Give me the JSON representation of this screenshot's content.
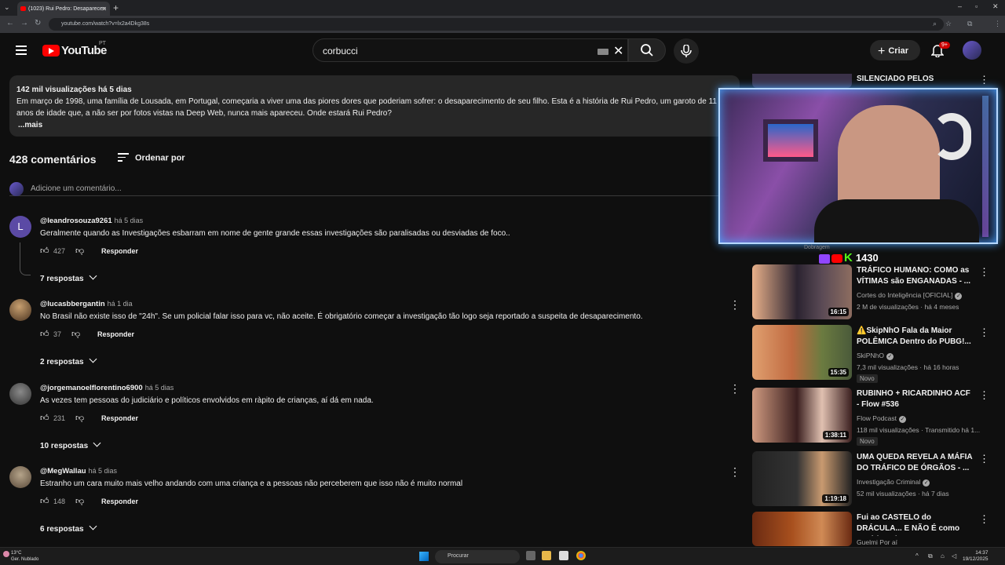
{
  "browser": {
    "tab_title": "(1023) Rui Pedro: Desaparecen",
    "url": "youtube.com/watch?v=lx2a4Dkg38s"
  },
  "header": {
    "logo_text": "YouTube",
    "region": "PT",
    "search_value": "corbucci",
    "create_label": "Criar",
    "notif_badge": "9+"
  },
  "description": {
    "meta": "142 mil visualizações  há 5 dias",
    "text": "Em março de 1998, uma família de Lousada, em Portugal, começaria a viver uma das piores dores que poderiam sofrer: o desaparecimento de seu filho. Esta é a história de Rui Pedro, um garoto de 11 anos de idade que, a não ser por fotos vistas na Deep Web, nunca mais apareceu. Onde estará Rui Pedro?",
    "more": "...mais"
  },
  "comments_header": {
    "count": "428 comentários",
    "sort_label": "Ordenar por",
    "add_placeholder": "Adicione um comentário..."
  },
  "comments": [
    {
      "avatar_letter": "L",
      "user": "@leandrosouza9261",
      "time": "há 5 dias",
      "text": "Geralmente quando as Investigações esbarram em nome de gente grande essas investigações são paralisadas ou desviadas de foco..",
      "likes": "427",
      "reply_label": "Responder",
      "replies": "7 respostas"
    },
    {
      "avatar_letter": "",
      "user": "@lucasbbergantin",
      "time": "há 1 dia",
      "text": "No Brasil não existe isso de \"24h\". Se um policial falar isso para vc, não aceite. É obrigatório começar a investigação tão logo seja reportado a suspeita de desaparecimento.",
      "likes": "37",
      "reply_label": "Responder",
      "replies": "2 respostas"
    },
    {
      "avatar_letter": "",
      "user": "@jorgemanoelflorentino6900",
      "time": "há 5 dias",
      "text": "As vezes tem pessoas do judiciário e políticos envolvidos em ràpito de crianças, aí dá em nada.",
      "likes": "231",
      "reply_label": "Responder",
      "replies": "10 respostas"
    },
    {
      "avatar_letter": "",
      "user": "@MegWallau",
      "time": "há 5 dias",
      "text": "Estranho um cara muito mais velho andando com uma criança e a pessoas não perceberem que isso não é muito normal",
      "likes": "148",
      "reply_label": "Responder",
      "replies": "6 respostas"
    }
  ],
  "sidebar": {
    "top_partial_title": "SILENCIADO PELOS",
    "cam_strip_label": "Dobragem",
    "counter_value": "1430",
    "videos": [
      {
        "title": "TRÁFICO HUMANO: COMO as VÍTIMAS são ENGANADAS - ...",
        "channel": "Cortes do Inteligência [OFICIAL]",
        "stats": "2 M de visualizações · há 4 meses",
        "duration": "16:15",
        "badge": "",
        "thumb_color": "#2b2330"
      },
      {
        "title": "⚠️SkipNhO Fala da Maior POLÊMICA Dentro do PUBG!...",
        "channel": "SkiPNhO",
        "stats": "7,3 mil visualizações · há 16 horas",
        "duration": "15:35",
        "badge": "Novo",
        "thumb_color": "#5a6b3a"
      },
      {
        "title": "RUBINHO + RICARDINHO ACF - Flow #536",
        "channel": "Flow Podcast",
        "stats": "118 mil visualizações · Transmitido há 1...",
        "duration": "1:38:11",
        "badge": "Novo",
        "thumb_color": "#3a1f1f"
      },
      {
        "title": "UMA QUEDA REVELA A MÁFIA DO TRÁFICO DE ÓRGÃOS - ...",
        "channel": "Investigação Criminal",
        "stats": "52 mil visualizações · há 7 dias",
        "duration": "1:19:18",
        "badge": "",
        "thumb_color": "#222"
      },
      {
        "title": "Fui ao CASTELO do DRÁCULA... E NÃO É como você imagina!!",
        "channel": "Guelmi Por aí",
        "stats": "",
        "duration": "",
        "badge": "",
        "thumb_color": "#6a2a12"
      }
    ]
  },
  "taskbar": {
    "temp": "13°C",
    "weather": "Ger. Nublado",
    "search_label": "Procurar",
    "time": "14:37",
    "date": "19/12/2025"
  }
}
